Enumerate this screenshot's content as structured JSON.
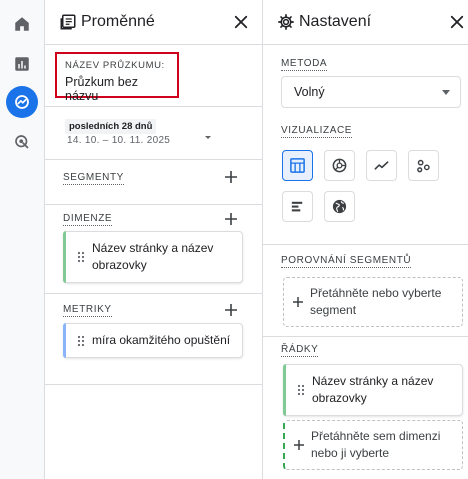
{
  "rail": {
    "items": [
      {
        "name": "home-icon",
        "active": false
      },
      {
        "name": "reports-icon",
        "active": false
      },
      {
        "name": "explore-icon",
        "active": true
      },
      {
        "name": "advertising-icon",
        "active": false
      }
    ]
  },
  "variables": {
    "title": "Proměnné",
    "exploration_name_label": "NÁZEV PRŮZKUMU:",
    "exploration_name_value": "Průzkum bez názvu",
    "date_chip": "posledních 28 dnů",
    "date_range": "14. 10. – 10. 11. 2025",
    "segments_label": "SEGMENTY",
    "dimensions_label": "DIMENZE",
    "dimensions": [
      "Název stránky a název obrazovky"
    ],
    "metrics_label": "METRIKY",
    "metrics": [
      "míra okamžitého opuštění"
    ]
  },
  "settings": {
    "title": "Nastavení",
    "method_label": "METODA",
    "method_value": "Volný",
    "visualization_label": "VIZUALIZACE",
    "visualizations": [
      "table-icon",
      "donut-chart-icon",
      "line-chart-icon",
      "scatter-plot-icon",
      "bar-chart-icon",
      "geo-map-icon"
    ],
    "segment_comparison_label": "POROVNÁNÍ SEGMENTŮ",
    "segment_drop_text": "Přetáhněte nebo vyberte segment",
    "rows_label": "ŘÁDKY",
    "rows": [
      "Název stránky a název obrazovky"
    ],
    "rows_drop_text": "Přetáhněte sem dimenzi nebo ji vyberte"
  },
  "colors": {
    "accent": "#1a73e8",
    "dimension_bar": "#81c995",
    "metric_bar": "#8ab4f8",
    "highlight_box": "#d0021b"
  }
}
